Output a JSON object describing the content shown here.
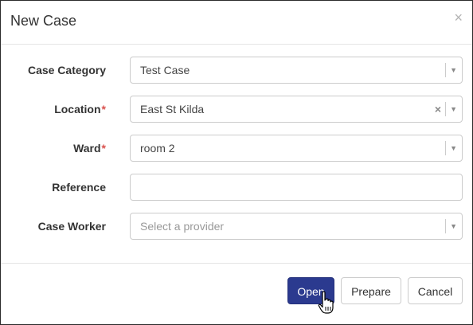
{
  "dialog": {
    "title": "New Case",
    "close_glyph": "×"
  },
  "form": {
    "fields": [
      {
        "label": "Case Category",
        "required": false,
        "type": "select",
        "value": "Test Case"
      },
      {
        "label": "Location",
        "required": true,
        "type": "select",
        "value": "East St Kilda",
        "clearable": true
      },
      {
        "label": "Ward",
        "required": true,
        "type": "select",
        "value": "room 2"
      },
      {
        "label": "Reference",
        "required": false,
        "type": "text",
        "value": ""
      },
      {
        "label": "Case Worker",
        "required": false,
        "type": "select",
        "value": "",
        "placeholder": "Select a provider"
      }
    ],
    "required_marker": "*",
    "dropdown_glyph": "▼",
    "clear_glyph": "×"
  },
  "footer": {
    "open_label": "Open",
    "prepare_label": "Prepare",
    "cancel_label": "Cancel"
  },
  "colors": {
    "primary": "#2b3a8f",
    "required": "#d9534f"
  },
  "icons": {
    "cursor": "hand-pointer-icon"
  }
}
